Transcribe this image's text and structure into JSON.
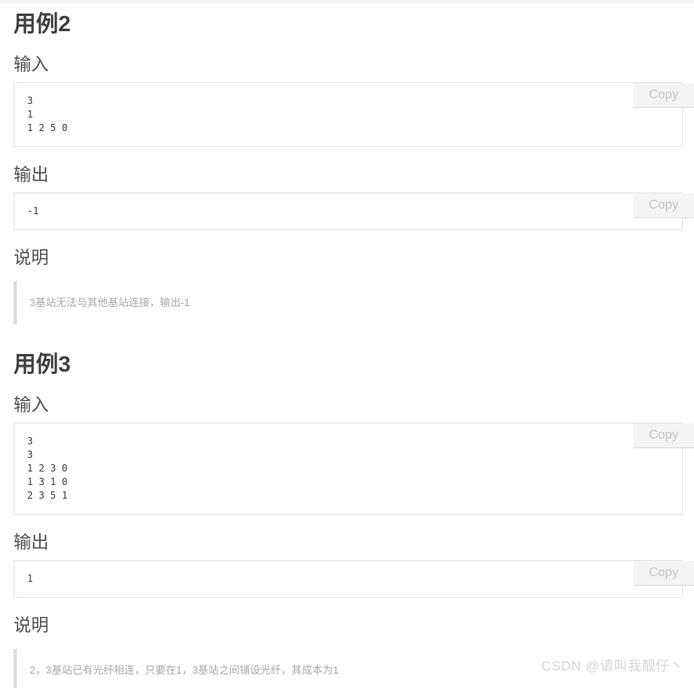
{
  "watermark": "CSDN @请叫我靓仔丶",
  "copy_label": "Copy",
  "sections": [
    {
      "title": "用例2",
      "input_label": "输入",
      "input_code": "3\n1\n1 2 5 0",
      "output_label": "输出",
      "output_code": "-1",
      "note_label": "说明",
      "note_text": "3基站无法与其他基站连接，输出-1"
    },
    {
      "title": "用例3",
      "input_label": "输入",
      "input_code": "3\n3\n1 2 3 0\n1 3 1 0\n2 3 5 1",
      "output_label": "输出",
      "output_code": "1",
      "note_label": "说明",
      "note_text": "2，3基站已有光纤相连，只要在1，3基站之间铺设光纤，其成本为1"
    }
  ]
}
